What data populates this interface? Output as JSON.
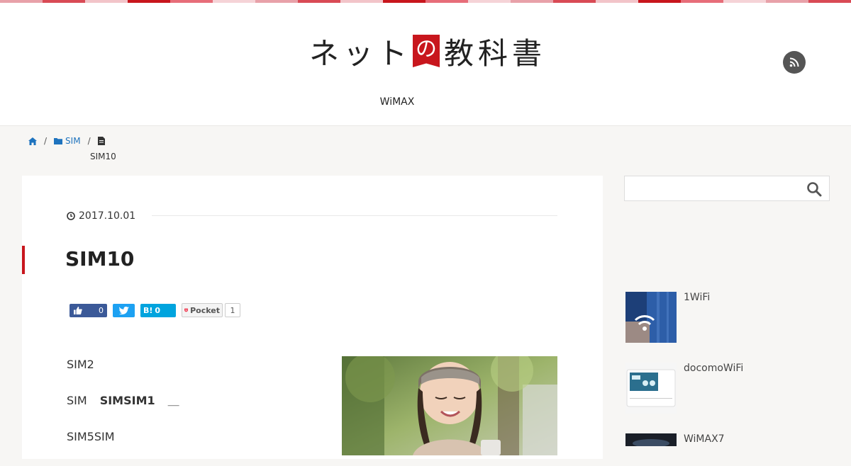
{
  "colors": {
    "accent": "#c8161d",
    "link": "#1e73be",
    "stripe": [
      "#e8a1a9",
      "#d94a55",
      "#f2c4c9",
      "#c8161d",
      "#e76d79",
      "#f5d3d7"
    ]
  },
  "header": {
    "logo_text_before": "ネット",
    "logo_badge": "の",
    "logo_text_after": "教科書",
    "rss_icon": "rss-icon",
    "nav": [
      {
        "label": "WiMAX"
      }
    ]
  },
  "breadcrumb": {
    "home_icon": "home-icon",
    "category_icon": "folder-icon",
    "category": "SIM",
    "separator": "/",
    "page_icon": "document-icon",
    "current": "SIM10"
  },
  "article": {
    "date": "2017.10.01",
    "clock_icon": "clock-icon",
    "title": "SIM10",
    "share": {
      "facebook_count": "0",
      "hatena_label": "B!",
      "hatena_count": "0",
      "pocket_label": "Pocket",
      "pocket_count": "1"
    },
    "paragraphs": {
      "p1": "SIM2",
      "p2_start": "SIM",
      "p2_bold": "SIMSIM1",
      "p2_end": "＿",
      "p3": "SIM5SIM"
    }
  },
  "sidebar": {
    "search_placeholder": "",
    "search_icon": "search-icon",
    "posts": [
      {
        "title": "1WiFi"
      },
      {
        "title": "docomoWiFi"
      },
      {
        "title": "WiMAX7"
      }
    ]
  }
}
